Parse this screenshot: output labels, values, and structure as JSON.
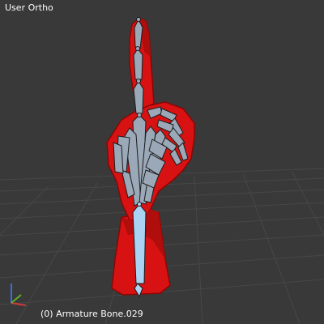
{
  "viewport": {
    "view_name": "User Ortho",
    "status": "(0) Armature Bone.029",
    "colors": {
      "background": "#393939",
      "grid_line": "#474747",
      "mesh_red": "#d81212",
      "mesh_red_dark": "#8a0606",
      "bone_fill": "#9aa8b8",
      "bone_outline": "#1c1c1c",
      "bone_selected": "#a9d2f3",
      "axis_x": "#d23a3a",
      "axis_y": "#5fb02a",
      "axis_z": "#3c6de0"
    }
  },
  "gizmo": {
    "icon": "axis-gizmo-icon"
  }
}
